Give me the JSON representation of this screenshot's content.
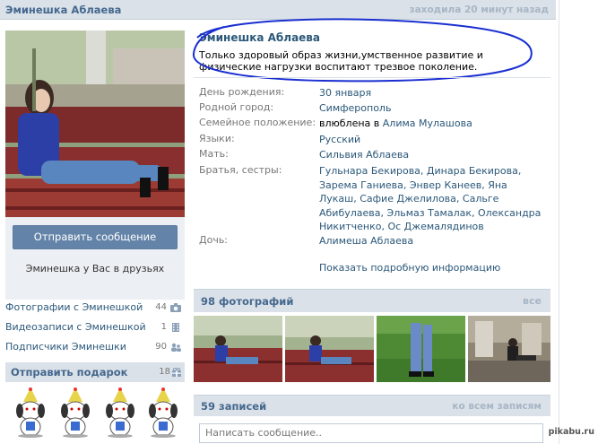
{
  "header": {
    "name": "Эминешка Аблаева",
    "last_seen": "заходила 20 минут назад"
  },
  "sidebar": {
    "send_message_button": "Отправить сообщение",
    "friend_note": "Эминешка у Вас в друзьях",
    "links": [
      {
        "label": "Фотографии с Эминешкой",
        "count": "44",
        "icon": "camera-icon"
      },
      {
        "label": "Видеозаписи с Эминешкой",
        "count": "1",
        "icon": "film-icon"
      },
      {
        "label": "Подписчики Эминешки",
        "count": "90",
        "icon": "users-icon"
      }
    ],
    "gifts": {
      "title": "Отправить подарок",
      "count": "18",
      "icon": "gift-icon"
    }
  },
  "status": {
    "name": "Эминешка Аблаева",
    "text": "Только здоровый образ жизни,умственное развитие и физические нагрузки воспитают трезвое поколение."
  },
  "info": {
    "rows": [
      {
        "label": "День рождения:",
        "value": "30 января"
      },
      {
        "label": "Родной город:",
        "value": "Симферополь"
      },
      {
        "label": "Семейное положение:",
        "value_prefix": "влюблена в",
        "value": "Алима Мулашова"
      },
      {
        "label": "Языки:",
        "value": "Русский"
      },
      {
        "label": "Мать:",
        "value": "Сильвия Аблаева"
      },
      {
        "label": "Братья, сестры:",
        "value": "Гульнара Бекирова, Динара Бекирова, Зарема Ганиева, Энвер Канеев, Яна Лукаш, Сафие Джелилова, Сальге Абибулаева, Эльмаз Тамалак, Олександра Никитченко, Ос Джемалядинов"
      },
      {
        "label": "Дочь:",
        "value": "Алимеша Аблаева"
      }
    ],
    "show_more": "Показать подробную информацию"
  },
  "photos": {
    "title": "98 фотографий",
    "all_link": "все"
  },
  "posts": {
    "title": "59 записей",
    "all_link": "ко всем записям",
    "input_placeholder": "Написать сообщение.."
  },
  "watermark": "pikabu.ru",
  "colors": {
    "link": "#2b587a",
    "header_bg": "#dae1e8",
    "button": "#6383a8",
    "annotation_circle": "#1a2fd0"
  }
}
